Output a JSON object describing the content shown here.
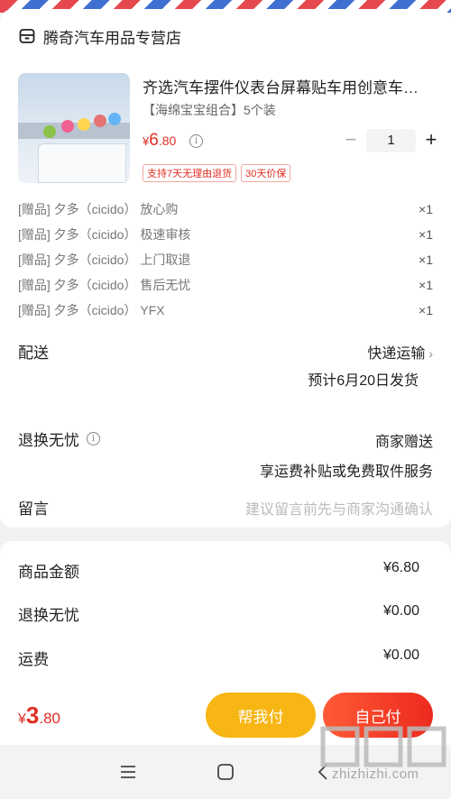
{
  "shop": {
    "name": "腾奇汽车用品专营店",
    "icon": "store-icon"
  },
  "product": {
    "title": "齐选汽车摆件仪表台屏幕贴车用创意车…",
    "spec": "【海绵宝宝组合】5个装",
    "price": {
      "yen": "¥",
      "int": "6",
      "dec": ".80"
    },
    "quantity": "1",
    "minus": "−",
    "plus": "+",
    "tags": [
      "支持7天无理由退货",
      "30天价保"
    ]
  },
  "gifts": [
    {
      "label": "[赠品] 夕多（cicido） 放心购",
      "count": "×1"
    },
    {
      "label": "[赠品] 夕多（cicido） 极速审核",
      "count": "×1"
    },
    {
      "label": "[赠品] 夕多（cicido） 上门取退",
      "count": "×1"
    },
    {
      "label": "[赠品] 夕多（cicido） 售后无忧",
      "count": "×1"
    },
    {
      "label": "[赠品] 夕多（cicido） YFX",
      "count": "×1"
    }
  ],
  "delivery": {
    "label": "配送",
    "method": "快递运输",
    "eta": "预计6月20日发货"
  },
  "returns": {
    "label": "退换无忧",
    "value": "商家赠送",
    "detail": "享运费补贴或免费取件服务"
  },
  "message": {
    "label": "留言",
    "placeholder": "建议留言前先与商家沟通确认"
  },
  "summary": [
    {
      "label": "商品金额",
      "value": "¥6.80"
    },
    {
      "label": "退换无忧",
      "value": "¥0.00"
    },
    {
      "label": "运费",
      "value": "¥0.00"
    }
  ],
  "checkout": {
    "total": {
      "yen": "¥",
      "int": "3",
      "dec": ".80"
    },
    "help_pay": "帮我付",
    "self_pay": "自己付"
  },
  "watermark": {
    "text": "zhizhizhi.com"
  },
  "colors": {
    "accent": "#e02e24",
    "help_button": "#f7b614",
    "self_button": "#ec2a1e"
  }
}
